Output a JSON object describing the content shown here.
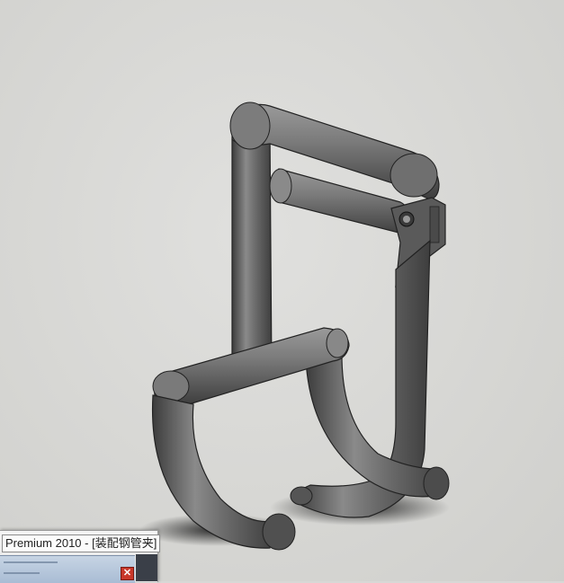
{
  "window": {
    "title_text": "Premium 2010 - [装配钢管夹]"
  },
  "viewport": {
    "background_color": "#d8d8d6",
    "model_color": "#6e6e6e",
    "model_name": "钢管夹 assembly (shaded, gray)"
  },
  "taskbar": {
    "close_icon": "close-icon"
  }
}
